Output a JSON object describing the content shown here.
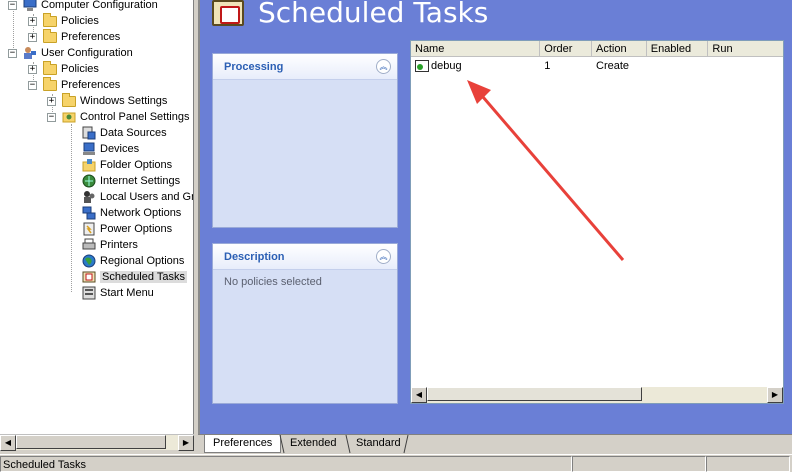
{
  "tree": {
    "items": [
      {
        "label": "Computer Configuration",
        "icon": "computer-config-icon"
      },
      {
        "label": "Policies",
        "icon": "folder-icon"
      },
      {
        "label": "Preferences",
        "icon": "folder-icon"
      },
      {
        "label": "User Configuration",
        "icon": "user-config-icon"
      },
      {
        "label": "Policies",
        "icon": "folder-icon"
      },
      {
        "label": "Preferences",
        "icon": "folder-icon"
      },
      {
        "label": "Windows Settings",
        "icon": "folder-icon"
      },
      {
        "label": "Control Panel Settings",
        "icon": "control-panel-icon"
      },
      {
        "label": "Data Sources",
        "icon": "data-sources-icon"
      },
      {
        "label": "Devices",
        "icon": "devices-icon"
      },
      {
        "label": "Folder Options",
        "icon": "folder-options-icon"
      },
      {
        "label": "Internet Settings",
        "icon": "internet-settings-icon"
      },
      {
        "label": "Local Users and Gr",
        "icon": "local-users-icon"
      },
      {
        "label": "Network Options",
        "icon": "network-options-icon"
      },
      {
        "label": "Power Options",
        "icon": "power-options-icon"
      },
      {
        "label": "Printers",
        "icon": "printers-icon"
      },
      {
        "label": "Regional Options",
        "icon": "regional-options-icon"
      },
      {
        "label": "Scheduled Tasks",
        "icon": "scheduled-tasks-icon"
      },
      {
        "label": "Start Menu",
        "icon": "start-menu-icon"
      }
    ],
    "expanders": {
      "collapsed": "+",
      "expanded": "−"
    }
  },
  "header": {
    "title": "Scheduled Tasks"
  },
  "processing": {
    "title": "Processing"
  },
  "description": {
    "title": "Description",
    "body": "No policies selected"
  },
  "list": {
    "columns": [
      "Name",
      "Order",
      "Action",
      "Enabled",
      "Run"
    ],
    "rows": [
      {
        "name": "debug",
        "order": "1",
        "action": "Create",
        "enabled": "",
        "run": ""
      }
    ]
  },
  "tabs": [
    "Preferences",
    "Extended",
    "Standard"
  ],
  "status": {
    "text": "Scheduled Tasks"
  },
  "colors": {
    "accent": "#6a7fd6",
    "panel_title": "#2b5fb4",
    "annotation_arrow": "#e8413a"
  }
}
